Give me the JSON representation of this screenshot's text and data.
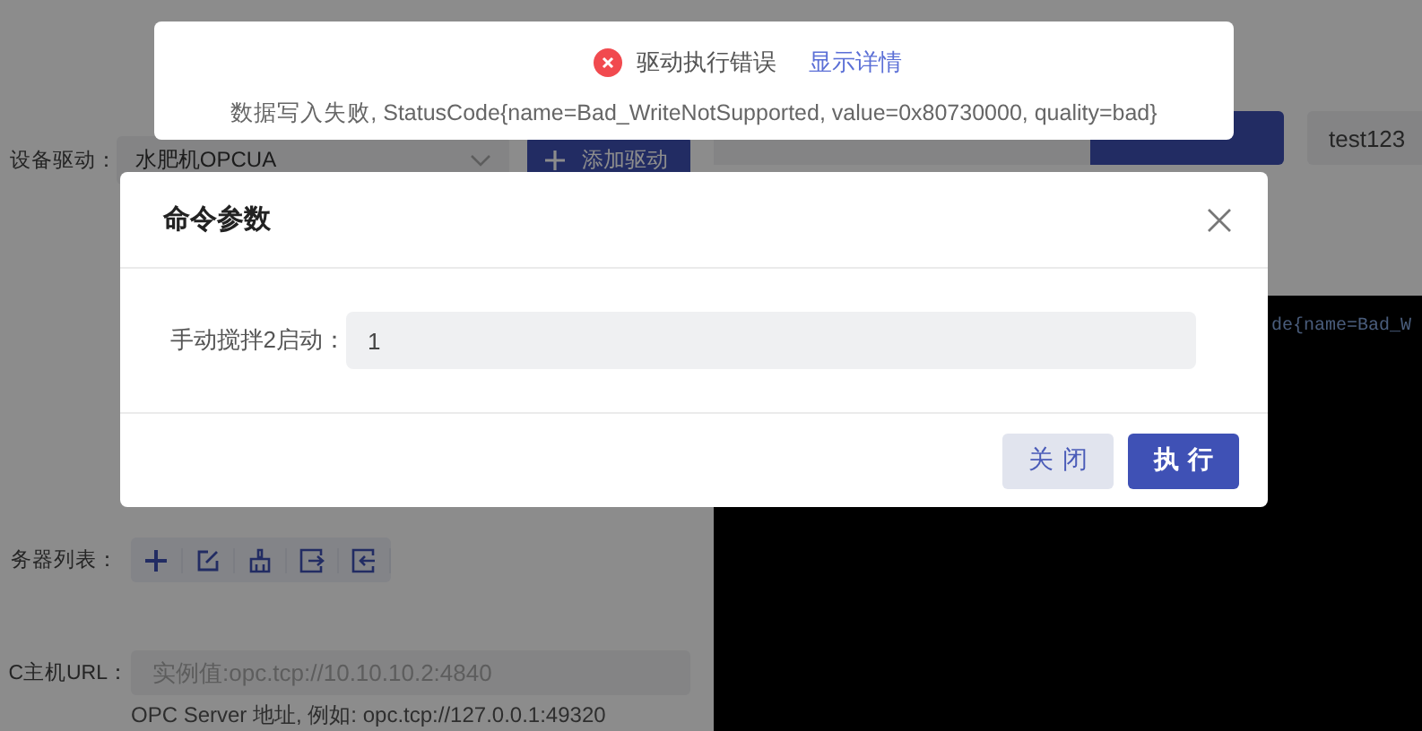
{
  "page": {
    "driver_label": "设备驱动：",
    "driver_select": "水肥机OPCUA",
    "add_driver_button": "添加驱动",
    "server_list_label": "务器列表：",
    "url_label": "C主机URL：",
    "url_placeholder": "实例值:opc.tcp://10.10.10.2:4840",
    "url_hint": "OPC Server 地址, 例如: opc.tcp://127.0.0.1:49320",
    "tag": "test123",
    "console_lines": [
      "de{name=Bad_W"
    ]
  },
  "toast": {
    "title": "驱动执行错误",
    "link": "显示详情",
    "message": "数据写入失败, StatusCode{name=Bad_WriteNotSupported, value=0x80730000, quality=bad}"
  },
  "dialog": {
    "title": "命令参数",
    "fields": [
      {
        "label": "手动搅拌2启动：",
        "value": "1"
      }
    ],
    "buttons": [
      {
        "label": "关闭",
        "kind": "secondary"
      },
      {
        "label": "执行",
        "kind": "primary"
      }
    ]
  }
}
